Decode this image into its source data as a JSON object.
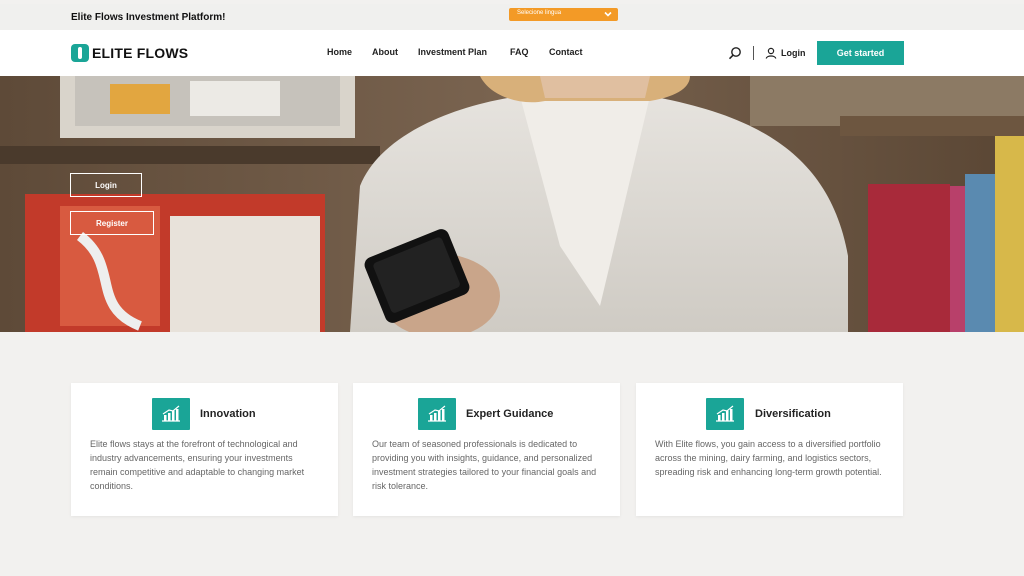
{
  "topbar": {
    "title": "Elite Flows Investment Platform!",
    "language_select": {
      "label": "Selecione lingua",
      "icon": "chevron-down-icon"
    }
  },
  "navbar": {
    "logo_text": "ELITE FLOWS",
    "links": [
      "Home",
      "About",
      "Investment Plan",
      "FAQ",
      "Contact"
    ],
    "login_label": "Login",
    "get_started_label": "Get started",
    "icons": [
      "search-icon",
      "user-icon"
    ]
  },
  "hero": {
    "login_label": "Login",
    "register_label": "Register"
  },
  "features": [
    {
      "icon": "chart-growth-icon",
      "title": "Innovation",
      "text": "Elite flows stays at the forefront of technological and industry advancements, ensuring your investments remain competitive and adaptable to changing market conditions."
    },
    {
      "icon": "chart-growth-icon",
      "title": "Expert Guidance",
      "text": "Our team of seasoned professionals is dedicated to providing you with insights, guidance, and personalized investment strategies tailored to your financial goals and risk tolerance."
    },
    {
      "icon": "chart-growth-icon",
      "title": "Diversification",
      "text": "With Elite flows, you gain access to a diversified portfolio across the mining, dairy farming, and logistics sectors, spreading risk and enhancing long-term growth potential."
    }
  ],
  "colors": {
    "accent": "#1aa597",
    "language_select": "#f39a26",
    "page_background": "#f2f1ef"
  }
}
